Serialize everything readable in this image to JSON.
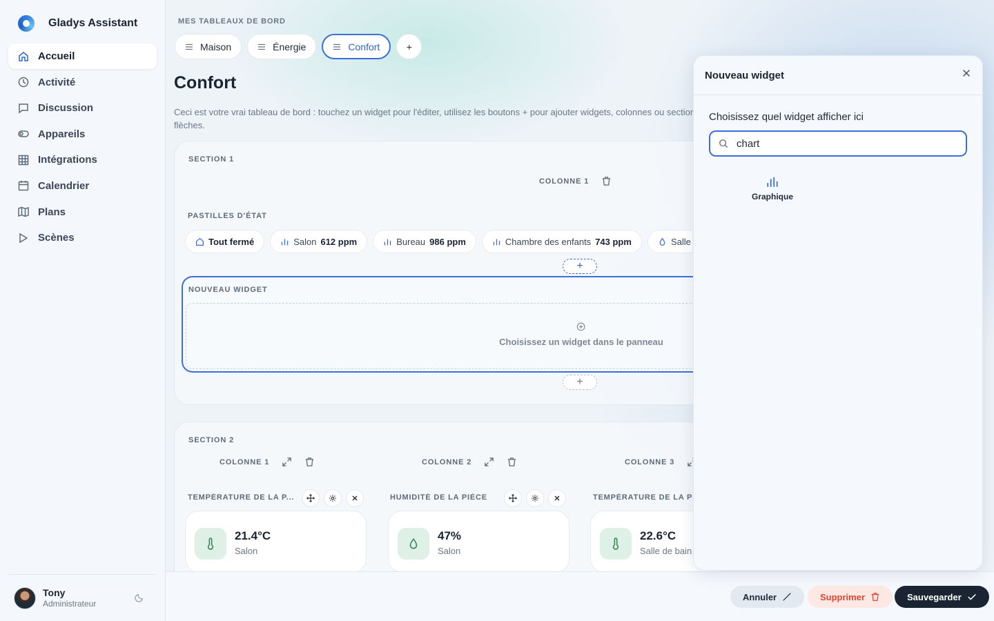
{
  "app": {
    "name": "Gladys Assistant"
  },
  "sidebar": {
    "items": [
      {
        "label": "Accueil",
        "icon": "home-icon",
        "active": true
      },
      {
        "label": "Activité",
        "icon": "clock-icon"
      },
      {
        "label": "Discussion",
        "icon": "chat-icon"
      },
      {
        "label": "Appareils",
        "icon": "toggle-icon"
      },
      {
        "label": "Intégrations",
        "icon": "grid-icon"
      },
      {
        "label": "Calendrier",
        "icon": "calendar-icon"
      },
      {
        "label": "Plans",
        "icon": "map-icon"
      },
      {
        "label": "Scènes",
        "icon": "play-icon"
      }
    ],
    "user": {
      "name": "Tony",
      "role": "Administrateur"
    }
  },
  "main": {
    "eyebrow": "MES TABLEAUX DE BORD",
    "tabs": [
      {
        "label": "Maison"
      },
      {
        "label": "Énergie"
      },
      {
        "label": "Confort",
        "active": true
      }
    ],
    "add_tab": "+",
    "title": "Confort",
    "description_line1": "Ceci est votre vrai tableau de bord : touchez un widget pour l'éditer, utilisez les boutons + pour ajouter widgets, colonnes ou sections",
    "description_line2": "flèches.",
    "section1": {
      "label": "SECTION 1",
      "column": "COLONNE 1",
      "widget_title": "PASTILLES D'ÉTAT",
      "pills": [
        {
          "label": "Tout fermé",
          "value": "",
          "icon": "home-icon"
        },
        {
          "label": "Salon",
          "value": "612 ppm",
          "icon": "bar-chart-icon"
        },
        {
          "label": "Bureau",
          "value": "986 ppm",
          "icon": "bar-chart-icon"
        },
        {
          "label": "Chambre des enfants",
          "value": "743 ppm",
          "icon": "bar-chart-icon"
        },
        {
          "label": "Salle",
          "value": "",
          "icon": "drop-icon"
        }
      ],
      "new_widget_label": "NOUVEAU WIDGET",
      "new_widget_hint": "Choisissez un widget dans le panneau",
      "add": "+"
    },
    "section2": {
      "label": "SECTION 2",
      "columns": [
        {
          "label": "COLONNE 1",
          "widget_title": "TEMPÉRATURE DE LA P...",
          "value": "21.4°C",
          "room": "Salon",
          "icon": "thermometer-icon"
        },
        {
          "label": "COLONNE 2",
          "widget_title": "HUMIDITÉ DE LA PIÈCE",
          "value": "47%",
          "room": "Salon",
          "icon": "drop-icon"
        },
        {
          "label": "COLONNE 3",
          "widget_title": "TEMPÉRATURE DE LA P",
          "value": "22.6°C",
          "room": "Salle de bain",
          "icon": "thermometer-icon"
        }
      ]
    }
  },
  "footer": {
    "cancel": "Annuler",
    "delete": "Supprimer",
    "save": "Sauvegarder"
  },
  "panel": {
    "title": "Nouveau widget",
    "question": "Choisissez quel widget afficher ici",
    "search_value": "chart",
    "results": [
      {
        "label": "Graphique",
        "icon": "bar-chart-icon"
      }
    ],
    "ghost_text": "bord"
  },
  "colors": {
    "accent": "#3a6fd8",
    "danger_bg": "#fde8e4",
    "danger_text": "#d9462f",
    "dark": "#1a2433",
    "icon_green_bg": "#dff0e6"
  }
}
